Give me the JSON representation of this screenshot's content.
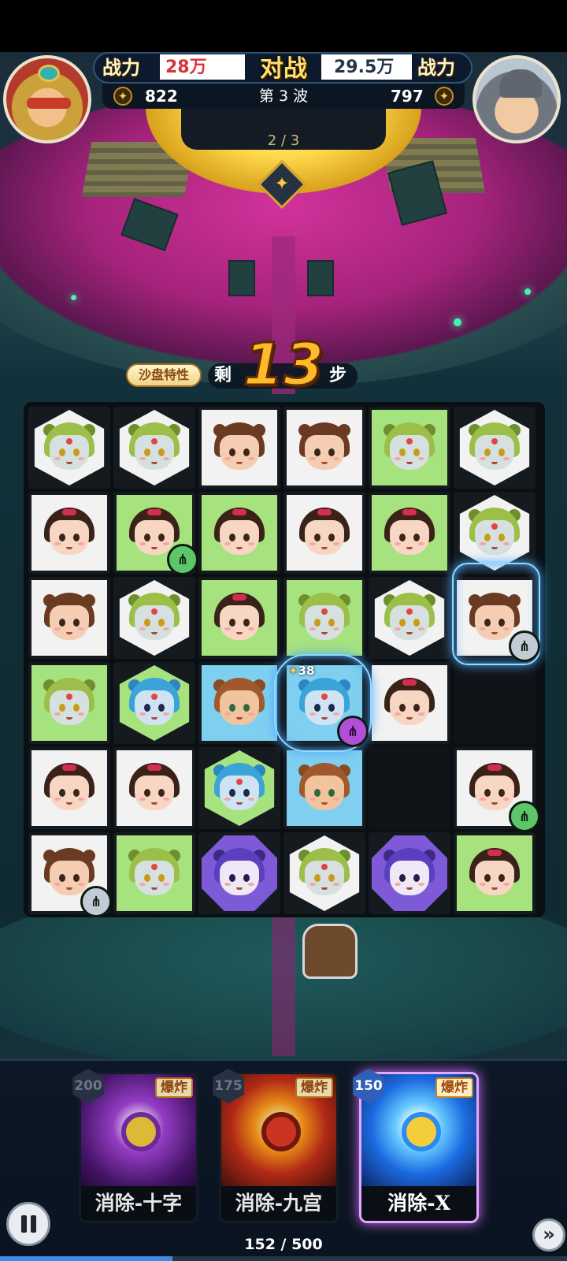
{
  "header": {
    "power_label_left": "战力",
    "power_left": "28万",
    "vs": "对战",
    "power_right": "29.5万",
    "power_label_right": "战力",
    "score_left": "822",
    "score_right": "797",
    "wave": "第 3 波",
    "wave_progress": "2 / 3",
    "colors": {
      "power_left": "#d9333a",
      "power_right": "#26344a"
    }
  },
  "steps": {
    "trait": "沙盘特性",
    "prefix": "剩",
    "remaining": "13",
    "suffix": "步"
  },
  "board": {
    "rows": [
      [
        "cat-hex-white",
        "cat-hex-white",
        "bun-sq-white",
        "bun-sq-white",
        "cat-sq-green",
        "cat-hex-white"
      ],
      [
        "girl-circ-white",
        "girl-circ-green",
        "girl-circ-green",
        "girl-circ-white",
        "girl-circ-green",
        "cat-hex-white"
      ],
      [
        "bun-sq-white",
        "cat-hex-white",
        "girl-circ-green",
        "cat-sq-green",
        "cat-hex-white",
        "bun-sq-white"
      ],
      [
        "cat-sq-green",
        "fish-hex-green",
        "bear-sq-blue",
        "fish-sq-blue",
        "girl-circ-white",
        "empty"
      ],
      [
        "girl-circ-white",
        "girl-circ-white",
        "fish-hex-green",
        "bear-sq-blue",
        "empty",
        "girl-circ-white"
      ],
      [
        "bun-sq-white",
        "cat-sq-green",
        "monster-oct-purple",
        "cat-hex-white",
        "monster-oct-purple",
        "girl-circ-green"
      ]
    ],
    "gain": "38"
  },
  "cards": [
    {
      "cost": "200",
      "tag": "爆炸",
      "name": "消除-十字",
      "theme": "purple"
    },
    {
      "cost": "175",
      "tag": "爆炸",
      "name": "消除-九宫",
      "theme": "red"
    },
    {
      "cost": "150",
      "tag": "爆炸",
      "name": "消除-X",
      "theme": "blue"
    }
  ],
  "energy": {
    "current": 152,
    "max": 500,
    "text": "152 / 500"
  }
}
